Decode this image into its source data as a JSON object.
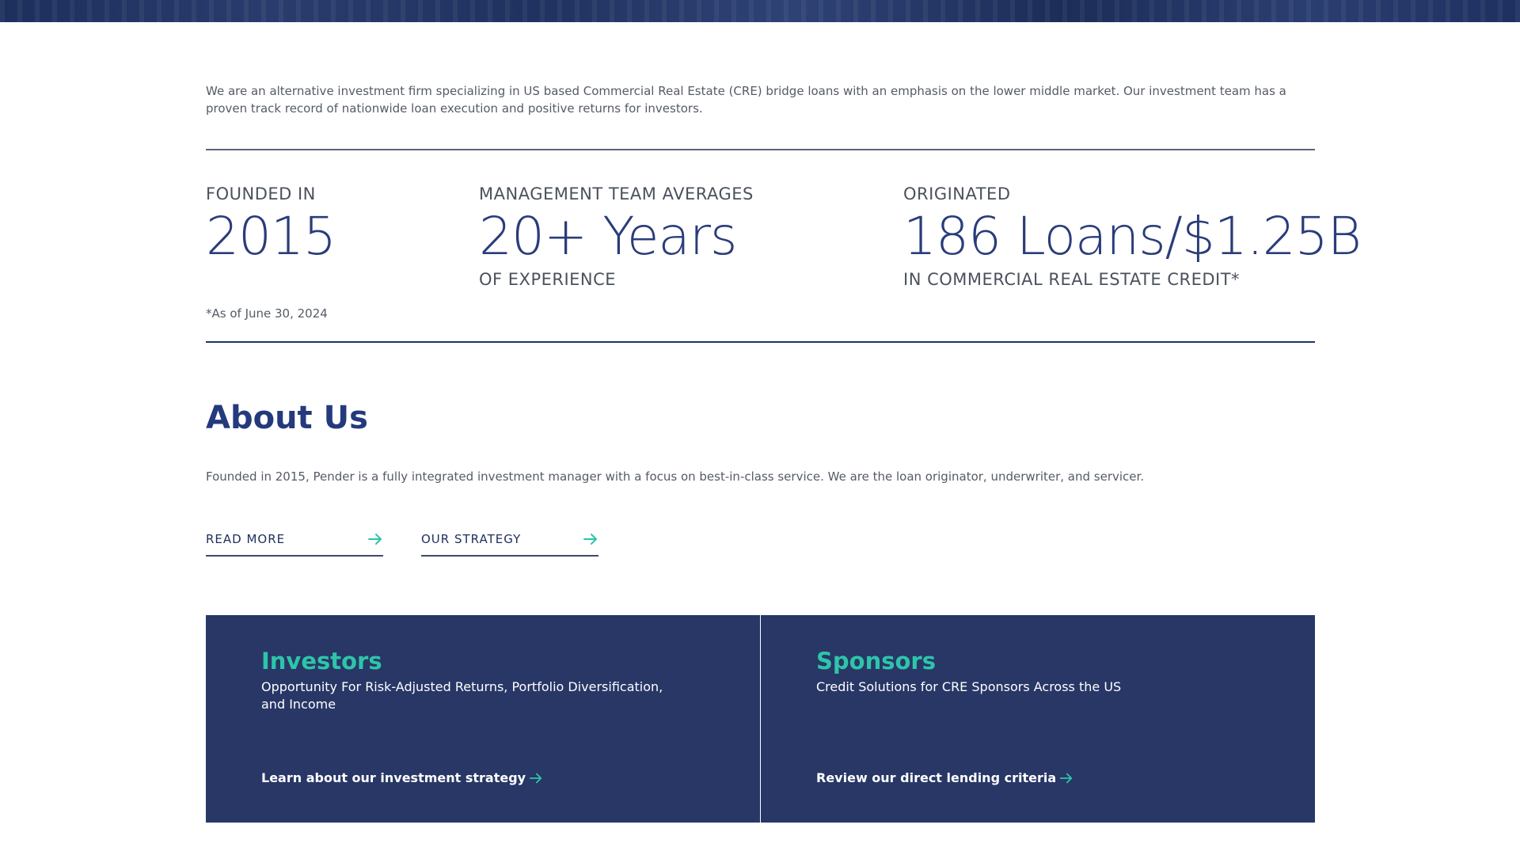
{
  "intro": {
    "text": "We are an alternative investment firm specializing in US based Commercial Real Estate (CRE) bridge loans with an emphasis on the lower middle market. Our investment team has a proven track record of nationwide loan execution and positive returns for investors."
  },
  "stats": [
    {
      "label": "FOUNDED IN",
      "value": "2015",
      "sub": ""
    },
    {
      "label": "MANAGEMENT TEAM AVERAGES",
      "value": "20+ Years",
      "sub": "OF EXPERIENCE"
    },
    {
      "label": "ORIGINATED",
      "value": "186 Loans/$1.25B",
      "sub": "IN COMMERCIAL REAL ESTATE CREDIT*"
    }
  ],
  "footnote": "*As of June 30, 2024",
  "about": {
    "title": "About Us",
    "text": "Founded in 2015, Pender is a fully integrated investment manager with a focus on best-in-class service. We are the loan originator, underwriter, and servicer.",
    "read_more": "READ MORE",
    "our_strategy": "OUR STRATEGY"
  },
  "cards": {
    "investors": {
      "title": "Investors",
      "subtitle": "Opportunity For Risk-Adjusted Returns, Portfolio Diversification, and Income",
      "link": "Learn about our investment strategy"
    },
    "sponsors": {
      "title": "Sponsors",
      "subtitle": "Credit Solutions for CRE Sponsors Across the US",
      "link": "Review our direct lending criteria"
    }
  },
  "colors": {
    "accent_teal": "#2ec4a9",
    "navy": "#283766",
    "heading_blue": "#243a7d"
  }
}
